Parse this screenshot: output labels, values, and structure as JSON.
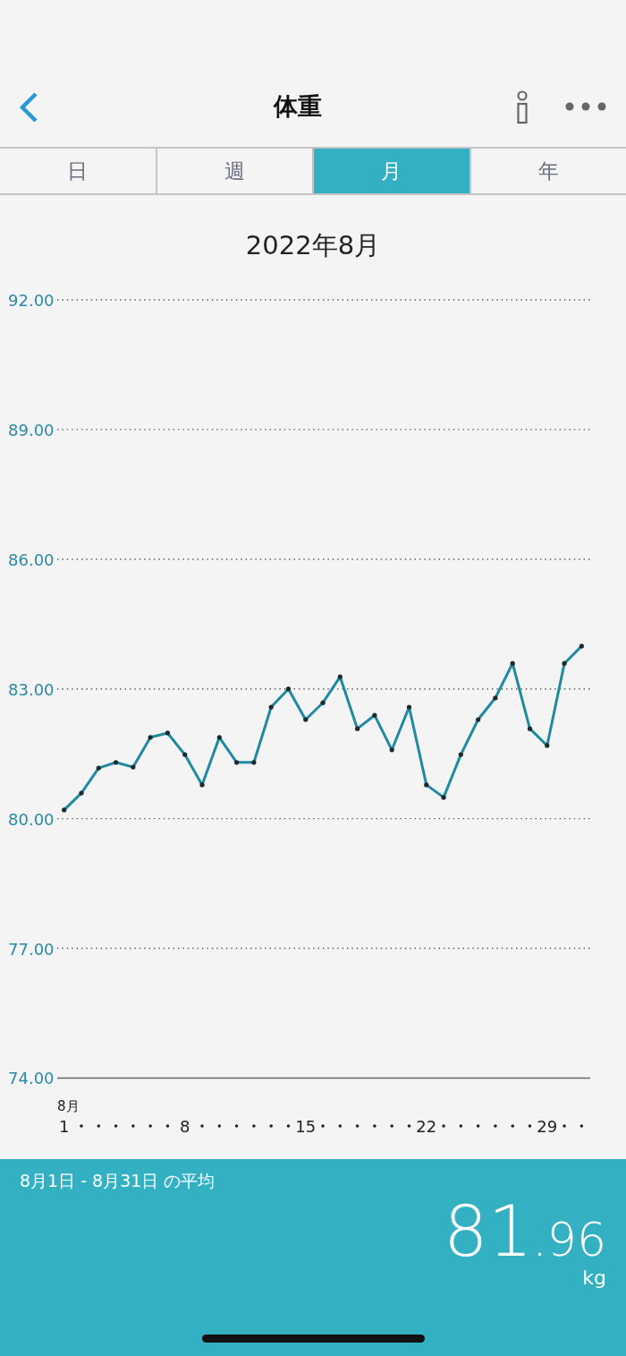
{
  "header": {
    "title": "体重"
  },
  "tabs": [
    {
      "label": "日",
      "selected": false
    },
    {
      "label": "週",
      "selected": false
    },
    {
      "label": "月",
      "selected": true
    },
    {
      "label": "年",
      "selected": false
    }
  ],
  "period_title": "2022年8月",
  "chart": {
    "chart_data": {
      "type": "line",
      "xlabel": "8月",
      "x": [
        1,
        2,
        3,
        4,
        5,
        6,
        7,
        8,
        9,
        10,
        11,
        12,
        13,
        14,
        15,
        16,
        17,
        18,
        19,
        20,
        21,
        22,
        23,
        24,
        25,
        26,
        27,
        28,
        29,
        30,
        31
      ],
      "series": [
        {
          "color": "#1f8aa0",
          "values": [
            80.2,
            80.59,
            81.17,
            81.3,
            81.19,
            81.88,
            81.98,
            81.48,
            80.78,
            81.88,
            81.3,
            81.3,
            82.58,
            83.0,
            82.29,
            82.68,
            83.28,
            82.08,
            82.39,
            81.59,
            82.58,
            80.78,
            80.49,
            81.48,
            82.29,
            82.79,
            83.59,
            82.08,
            81.69,
            83.59,
            83.99
          ]
        }
      ],
      "xlim": [
        0.6,
        31.5
      ],
      "ylim": [
        74,
        92
      ],
      "grid": true,
      "xticks": [
        1,
        8,
        15,
        22,
        29
      ],
      "yticks": [
        {
          "value": 92,
          "label": "92.00"
        },
        {
          "value": 89,
          "label": "89.00"
        },
        {
          "value": 86,
          "label": "86.00"
        },
        {
          "value": 83,
          "label": "83.00"
        },
        {
          "value": 80,
          "label": "80.00"
        },
        {
          "value": 77,
          "label": "77.00"
        },
        {
          "value": 74,
          "label": "74.00"
        }
      ]
    }
  },
  "summary": {
    "range_label": "8月1日 - 8月31日 の平均",
    "value_integer": "81",
    "value_decimal": ".96",
    "unit": "kg"
  }
}
